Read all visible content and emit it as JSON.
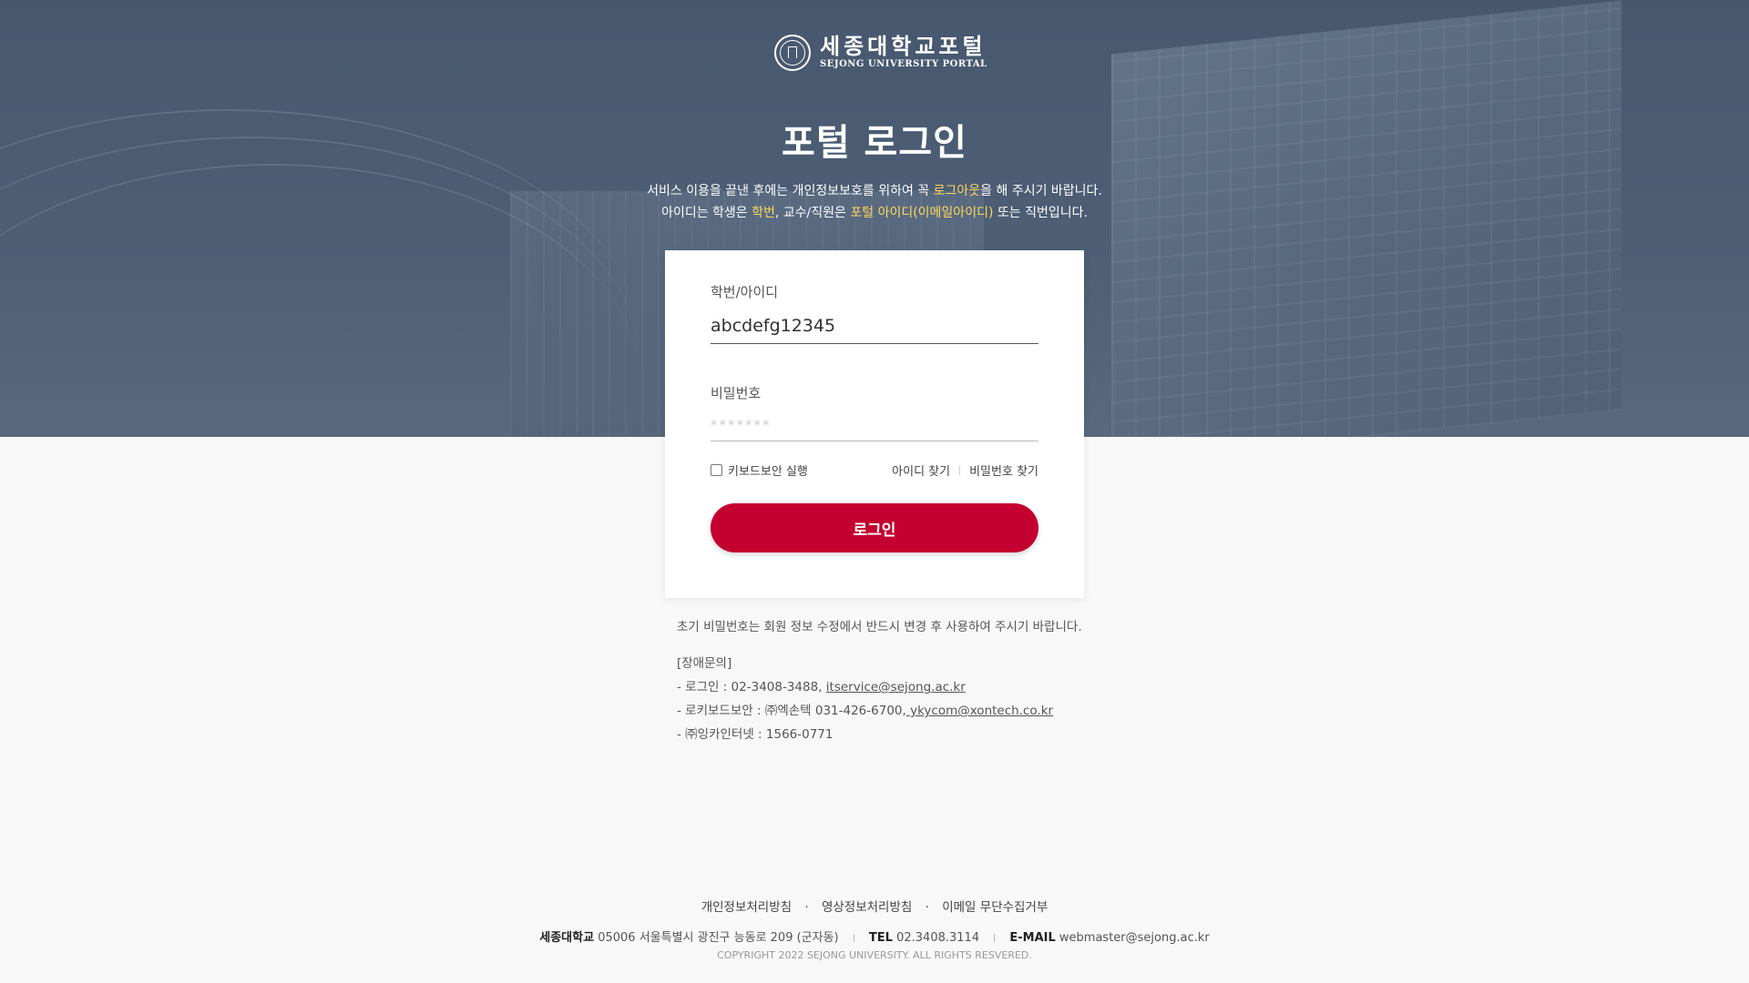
{
  "header": {
    "logo_ko": "세종대학교포털",
    "logo_en": "SEJONG UNIVERSITY PORTAL",
    "title": "포털 로그인"
  },
  "notice": {
    "line1_pre": "서비스 이용을 끝낸 후에는 개인정보보호를 위하여 꼭 ",
    "line1_hl": "로그아웃",
    "line1_post": "을 해 주시기 바랍니다.",
    "line2_pre": "아이디는 학생은 ",
    "line2_hl1": "학번",
    "line2_mid": ", 교수/직원은 ",
    "line2_hl2": "포털 아이디(이메일아이디)",
    "line2_post": " 또는 직번입니다."
  },
  "login_form": {
    "id_label": "학번/아이디",
    "id_value": "abcdefg12345",
    "pw_label": "비밀번호",
    "pw_value": "*******",
    "keyboard_security_label": "키보드보안 실행",
    "keyboard_security_checked": false,
    "find_id": "아이디 찾기",
    "find_password": "비밀번호 찾기",
    "login_button": "로그인"
  },
  "info": {
    "initial_pw_notice": "초기 비밀번호는 회원 정보 수정에서 반드시 변경 후 사용하여 주시기 바랍니다.",
    "support_title": "[장애문의]",
    "login_support_prefix": "- 로그인 : 02-3408-3488, ",
    "login_support_email": "itservice@sejong.ac.kr",
    "keyboard_support_prefix": "- 로키보드보안 : ㈜엑손텍 031-426-6700,",
    "keyboard_support_email": " ykycom@xontech.co.kr",
    "inca_support": "- ㈜잉카인터넷 : 1566-0771"
  },
  "footer": {
    "links": [
      "개인정보처리방침",
      "영상정보처리방침",
      "이메일 무단수집거부"
    ],
    "link_separator": "·",
    "org_name": "세종대학교",
    "address": "05006 서울특별시 광진구 능동로 209 (군자동)",
    "tel_label": "TEL",
    "tel": "02.3408.3114",
    "email_label": "E-MAIL",
    "email": "webmaster@sejong.ac.kr",
    "copyright": "COPYRIGHT 2022 SEJONG UNIVERSITY. ALL RIGHTS RESVERED."
  },
  "colors": {
    "accent": "#c3002f",
    "highlight": "#ffd95a",
    "hero_bg": "#4d5d74"
  }
}
